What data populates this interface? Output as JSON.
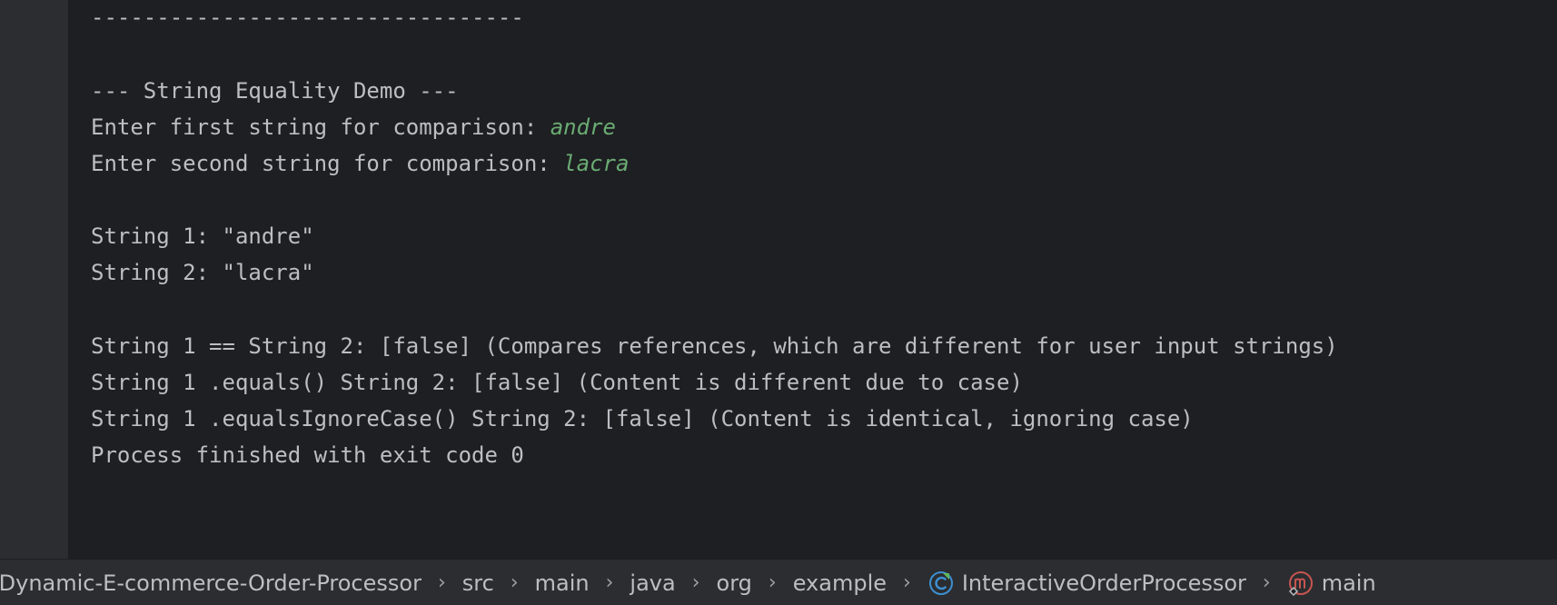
{
  "console": {
    "separator": "---------------------------------",
    "demo_header": "--- String Equality Demo ---",
    "prompt_first": "Enter first string for comparison: ",
    "input_first": "andre",
    "prompt_second": "Enter second string for comparison: ",
    "input_second": "lacra",
    "string1_line": "String 1: \"andre\"",
    "string2_line": "String 2: \"lacra\"",
    "compare_ref_line": "String 1 == String 2: [false] (Compares references, which are different for user input strings)",
    "compare_equals_line": "String 1 .equals() String 2: [false] (Content is different due to case)",
    "compare_ignorecase_line": "String 1 .equalsIgnoreCase() String 2: [false] (Content is identical, ignoring case)",
    "process_line": "Process finished with exit code 0"
  },
  "breadcrumbs": {
    "items": [
      {
        "label": "-Dynamic-E-commerce-Order-Processor"
      },
      {
        "label": "src"
      },
      {
        "label": "main"
      },
      {
        "label": "java"
      },
      {
        "label": "org"
      },
      {
        "label": "example"
      },
      {
        "label": "InteractiveOrderProcessor",
        "icon": "java-class-icon"
      },
      {
        "label": "main",
        "icon": "method-icon"
      }
    ],
    "separator": "›"
  },
  "colors": {
    "background": "#1e1f22",
    "panel": "#2b2d30",
    "text": "#bcbec4",
    "user_input": "#6aab73",
    "class_icon": "#3d8fd1",
    "method_icon": "#c75450"
  }
}
